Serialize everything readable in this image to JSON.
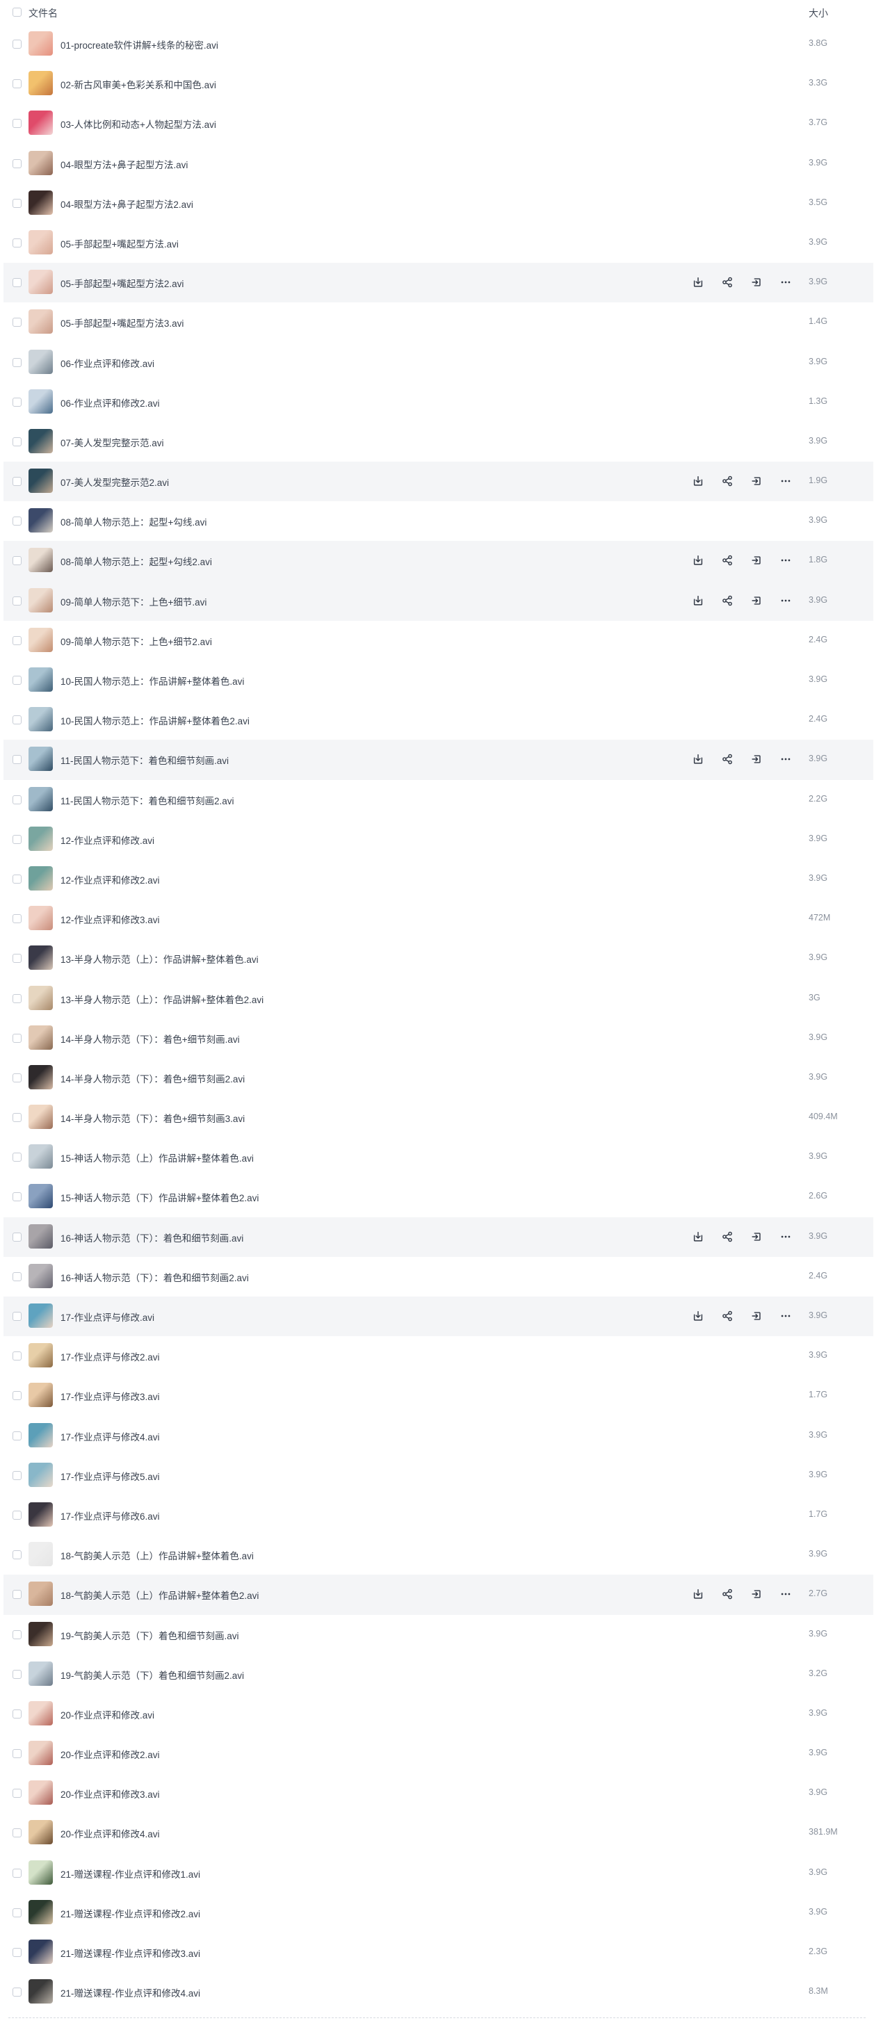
{
  "header": {
    "name_label": "文件名",
    "size_label": "大小"
  },
  "actions": [
    "download-icon",
    "share-icon",
    "move-icon",
    "more-icon"
  ],
  "files": [
    {
      "name": "01-procreate软件讲解+线条的秘密.avi",
      "size": "3.8G",
      "hover": false,
      "thumb": [
        "#f1c5b4",
        "#e58f7d"
      ]
    },
    {
      "name": "02-新古风审美+色彩关系和中国色.avi",
      "size": "3.3G",
      "hover": false,
      "thumb": [
        "#f2c16d",
        "#c4753c"
      ]
    },
    {
      "name": "03-人体比例和动态+人物起型方法.avi",
      "size": "3.7G",
      "hover": false,
      "thumb": [
        "#e04b6a",
        "#f3d6d6"
      ]
    },
    {
      "name": "04-眼型方法+鼻子起型方法.avi",
      "size": "3.9G",
      "hover": false,
      "thumb": [
        "#dcc0ad",
        "#8c6452"
      ]
    },
    {
      "name": "04-眼型方法+鼻子起型方法2.avi",
      "size": "3.5G",
      "hover": false,
      "thumb": [
        "#3a2a28",
        "#e3c2ad"
      ]
    },
    {
      "name": "05-手部起型+嘴起型方法.avi",
      "size": "3.9G",
      "hover": false,
      "thumb": [
        "#f0d3c6",
        "#d7a793"
      ]
    },
    {
      "name": "05-手部起型+嘴起型方法2.avi",
      "size": "3.9G",
      "hover": true,
      "thumb": [
        "#f1d8cf",
        "#cf9a88"
      ]
    },
    {
      "name": "05-手部起型+嘴起型方法3.avi",
      "size": "1.4G",
      "hover": false,
      "thumb": [
        "#ecd1c3",
        "#c99a86"
      ]
    },
    {
      "name": "06-作业点评和修改.avi",
      "size": "3.9G",
      "hover": false,
      "thumb": [
        "#ccd4da",
        "#6f7f8c"
      ]
    },
    {
      "name": "06-作业点评和修改2.avi",
      "size": "1.3G",
      "hover": false,
      "thumb": [
        "#c9d6e2",
        "#4a6d8c"
      ]
    },
    {
      "name": "07-美人发型完整示范.avi",
      "size": "3.9G",
      "hover": false,
      "thumb": [
        "#2f4f5e",
        "#c9b29c"
      ]
    },
    {
      "name": "07-美人发型完整示范2.avi",
      "size": "1.9G",
      "hover": true,
      "thumb": [
        "#2c4a59",
        "#bfa891"
      ]
    },
    {
      "name": "08-简单人物示范上：起型+勾线.avi",
      "size": "3.9G",
      "hover": false,
      "thumb": [
        "#3c4a6a",
        "#d6cfc4"
      ]
    },
    {
      "name": "08-简单人物示范上：起型+勾线2.avi",
      "size": "1.8G",
      "hover": true,
      "thumb": [
        "#e9ddd2",
        "#6b5a52"
      ]
    },
    {
      "name": "09-简单人物示范下：上色+细节.avi",
      "size": "3.9G",
      "hover": true,
      "thumb": [
        "#eddccf",
        "#b88a72"
      ]
    },
    {
      "name": "09-简单人物示范下：上色+细节2.avi",
      "size": "2.4G",
      "hover": false,
      "thumb": [
        "#efd9c8",
        "#c28c6e"
      ]
    },
    {
      "name": "10-民国人物示范上：作品讲解+整体着色.avi",
      "size": "3.9G",
      "hover": false,
      "thumb": [
        "#a9c3d1",
        "#3f5f76"
      ]
    },
    {
      "name": "10-民国人物示范上：作品讲解+整体着色2.avi",
      "size": "2.4G",
      "hover": false,
      "thumb": [
        "#b6cbd6",
        "#47657b"
      ]
    },
    {
      "name": "11-民国人物示范下：着色和细节刻画.avi",
      "size": "3.9G",
      "hover": true,
      "thumb": [
        "#a6c0cf",
        "#2f4c63"
      ]
    },
    {
      "name": "11-民国人物示范下：着色和细节刻画2.avi",
      "size": "2.2G",
      "hover": false,
      "thumb": [
        "#9fb9c9",
        "#334f66"
      ]
    },
    {
      "name": "12-作业点评和修改.avi",
      "size": "3.9G",
      "hover": false,
      "thumb": [
        "#7aa6a0",
        "#e3d2bd"
      ]
    },
    {
      "name": "12-作业点评和修改2.avi",
      "size": "3.9G",
      "hover": false,
      "thumb": [
        "#6fa19b",
        "#dfcab3"
      ]
    },
    {
      "name": "12-作业点评和修改3.avi",
      "size": "472M",
      "hover": false,
      "thumb": [
        "#f0d0c4",
        "#c98c7a"
      ]
    },
    {
      "name": "13-半身人物示范（上）：作品讲解+整体着色.avi",
      "size": "3.9G",
      "hover": false,
      "thumb": [
        "#3a3a48",
        "#d9c7b8"
      ]
    },
    {
      "name": "13-半身人物示范（上）：作品讲解+整体着色2.avi",
      "size": "3G",
      "hover": false,
      "thumb": [
        "#e6d6c0",
        "#a8896a"
      ]
    },
    {
      "name": "14-半身人物示范（下）：着色+细节刻画.avi",
      "size": "3.9G",
      "hover": false,
      "thumb": [
        "#e2c9b4",
        "#8a6a52"
      ]
    },
    {
      "name": "14-半身人物示范（下）：着色+细节刻画2.avi",
      "size": "3.9G",
      "hover": false,
      "thumb": [
        "#2e2a2c",
        "#d7bba6"
      ]
    },
    {
      "name": "14-半身人物示范（下）：着色+细节刻画3.avi",
      "size": "409.4M",
      "hover": false,
      "thumb": [
        "#f0d8c4",
        "#9a6c55"
      ]
    },
    {
      "name": "15-神话人物示范（上）作品讲解+整体着色.avi",
      "size": "3.9G",
      "hover": false,
      "thumb": [
        "#c8d2d9",
        "#7b8a95"
      ]
    },
    {
      "name": "15-神话人物示范（下）作品讲解+整体着色2.avi",
      "size": "2.6G",
      "hover": false,
      "thumb": [
        "#8aa1c0",
        "#2f4a72"
      ]
    },
    {
      "name": "16-神话人物示范（下）：着色和细节刻画.avi",
      "size": "3.9G",
      "hover": true,
      "thumb": [
        "#a8a4a8",
        "#5b5b66"
      ]
    },
    {
      "name": "16-神话人物示范（下）：着色和细节刻画2.avi",
      "size": "2.4G",
      "hover": false,
      "thumb": [
        "#b7b4b8",
        "#666470"
      ]
    },
    {
      "name": "17-作业点评与修改.avi",
      "size": "3.9G",
      "hover": true,
      "thumb": [
        "#5fa3c0",
        "#e6d2c2"
      ]
    },
    {
      "name": "17-作业点评与修改2.avi",
      "size": "3.9G",
      "hover": false,
      "thumb": [
        "#e7cfa8",
        "#8c6a43"
      ]
    },
    {
      "name": "17-作业点评与修改3.avi",
      "size": "1.7G",
      "hover": false,
      "thumb": [
        "#e8c9a6",
        "#7e5a3a"
      ]
    },
    {
      "name": "17-作业点评与修改4.avi",
      "size": "3.9G",
      "hover": false,
      "thumb": [
        "#5c9fb8",
        "#e5d3c6"
      ]
    },
    {
      "name": "17-作业点评与修改5.avi",
      "size": "3.9G",
      "hover": false,
      "thumb": [
        "#89b7c9",
        "#e8d9cb"
      ]
    },
    {
      "name": "17-作业点评与修改6.avi",
      "size": "1.7G",
      "hover": false,
      "thumb": [
        "#3a3640",
        "#e2c6b6"
      ]
    },
    {
      "name": "18-气韵美人示范（上）作品讲解+整体着色.avi",
      "size": "3.9G",
      "hover": false,
      "thumb": [
        "#eeeeee",
        "#e6e6e6"
      ]
    },
    {
      "name": "18-气韵美人示范（上）作品讲解+整体着色2.avi",
      "size": "2.7G",
      "hover": true,
      "thumb": [
        "#d9b69c",
        "#a77e64"
      ]
    },
    {
      "name": "19-气韵美人示范（下）着色和细节刻画.avi",
      "size": "3.9G",
      "hover": false,
      "thumb": [
        "#3b2e2a",
        "#c9a98e"
      ]
    },
    {
      "name": "19-气韵美人示范（下）着色和细节刻画2.avi",
      "size": "3.2G",
      "hover": false,
      "thumb": [
        "#c7d3dc",
        "#6e7c8a"
      ]
    },
    {
      "name": "20-作业点评和修改.avi",
      "size": "3.9G",
      "hover": false,
      "thumb": [
        "#f1d7cc",
        "#b8665a"
      ]
    },
    {
      "name": "20-作业点评和修改2.avi",
      "size": "3.9G",
      "hover": false,
      "thumb": [
        "#eed3c6",
        "#b05f55"
      ]
    },
    {
      "name": "20-作业点评和修改3.avi",
      "size": "3.9G",
      "hover": false,
      "thumb": [
        "#f0d2c6",
        "#a85a52"
      ]
    },
    {
      "name": "20-作业点评和修改4.avi",
      "size": "381.9M",
      "hover": false,
      "thumb": [
        "#e5c8a2",
        "#6b4b2e"
      ]
    },
    {
      "name": "21-赠送课程-作业点评和修改1.avi",
      "size": "3.9G",
      "hover": false,
      "thumb": [
        "#d4e2c8",
        "#3f5a3a"
      ]
    },
    {
      "name": "21-赠送课程-作业点评和修改2.avi",
      "size": "3.9G",
      "hover": false,
      "thumb": [
        "#2a3a2e",
        "#d8c2a4"
      ]
    },
    {
      "name": "21-赠送课程-作业点评和修改3.avi",
      "size": "2.3G",
      "hover": false,
      "thumb": [
        "#2f3b5a",
        "#e3cfc2"
      ]
    },
    {
      "name": "21-赠送课程-作业点评和修改4.avi",
      "size": "8.3M",
      "hover": false,
      "thumb": [
        "#3a3a3a",
        "#b8b0a6"
      ]
    }
  ]
}
